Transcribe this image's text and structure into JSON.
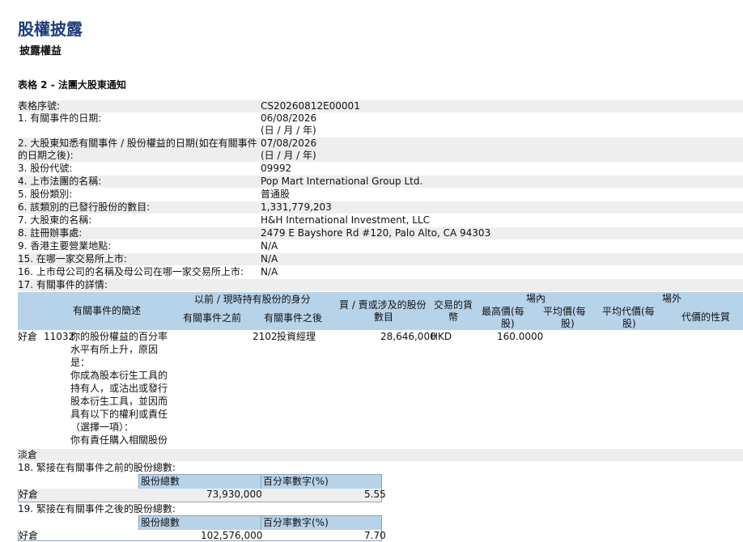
{
  "header": {
    "title": "股權披露",
    "subtitle": "披露權益",
    "form_title": "表格 2 - 法團大股東通知"
  },
  "fields": {
    "serial": {
      "label": "表格序號:",
      "value": "CS20260812E00001"
    },
    "event_date": {
      "label": "1. 有關事件的日期:",
      "value": "06/08/2026",
      "hint": "(日 / 月 / 年)"
    },
    "aware_date": {
      "label": "2. 大股東知悉有關事件 / 股份權益的日期(如在有關事件",
      "label_cont": "的日期之後):",
      "value": "07/08/2026",
      "hint": "(日 / 月 / 年)"
    },
    "stock_code": {
      "label": "3. 股份代號:",
      "value": "09992"
    },
    "corp_name": {
      "label": "4. 上市法團的名稱:",
      "value": "Pop Mart International Group Ltd."
    },
    "share_class": {
      "label": "5. 股份類別:",
      "value": "普通股"
    },
    "issued_shares": {
      "label": "6. 該類別的已發行股份的數目:",
      "value": "1,331,779,203"
    },
    "holder_name": {
      "label": "7. 大股東的名稱:",
      "value": "H&H International Investment, LLC"
    },
    "registered_office": {
      "label": "8. 註冊辦事處:",
      "value": "2479 E Bayshore Rd #120, Palo Alto, CA 94303"
    },
    "hk_place": {
      "label": "9. 香港主要營業地點:",
      "value": "N/A"
    },
    "exchange": {
      "label": "15. 在哪一家交易所上市:",
      "value": "N/A"
    },
    "parent_exchange": {
      "label": "16. 上市母公司的名稱及母公司在哪一家交易所上市:",
      "value": "N/A"
    },
    "details": {
      "label": "17. 有關事件的詳情:"
    }
  },
  "event_table": {
    "headers": {
      "event_code": "有關事件的簡述",
      "capacity": "以前 / 現時持有股份的身分",
      "before": "有關事件之前",
      "after": "有關事件之後",
      "shares_involved_1": "買 / 賣或涉及的股份",
      "shares_involved_2": "數目",
      "currency_1": "交易的貨",
      "currency_2": "幣",
      "on_exchange": "場內",
      "off_exchange": "場外",
      "highest_1": "最高價(每",
      "highest_2": "股)",
      "average_1": "平均價(每",
      "average_2": "股)",
      "avg_consideration_1": "平均代價(每",
      "avg_consideration_2": "股)",
      "consideration_nature": "代價的性質"
    },
    "row": {
      "position": "好倉",
      "event_code": "11032",
      "description_lines": [
        "你的股份權益的百分率",
        "水平有所上升，原因",
        "是：",
        "你成為股本衍生工具的",
        "持有人，或沽出或發行",
        "股本衍生工具，並因而",
        "具有以下的權利或責任",
        "（選擇一項）：",
        "你有責任購入相關股份"
      ],
      "capacity_code": "2102",
      "capacity_desc": "投資經理",
      "shares": "28,646,000",
      "currency": "HKD",
      "highest_price": "160.0000"
    },
    "short_label": "淡倉"
  },
  "section18": {
    "title": "18. 緊接在有關事件之前的股份總數:",
    "col_shares": "股份總數",
    "col_pct": "百分率數字(%)",
    "row_label": "好倉",
    "shares": "73,930,000",
    "pct": "5.55"
  },
  "section19": {
    "title": "19. 緊接在有關事件之後的股份總數:",
    "col_shares": "股份總數",
    "col_pct": "百分率數字(%)",
    "row_label": "好倉",
    "shares": "102,576,000",
    "pct": "7.70"
  },
  "colors": {
    "title": "#1f3d7a",
    "header_blue": "#b7d3ea",
    "row_shade": "#eeeeee"
  }
}
